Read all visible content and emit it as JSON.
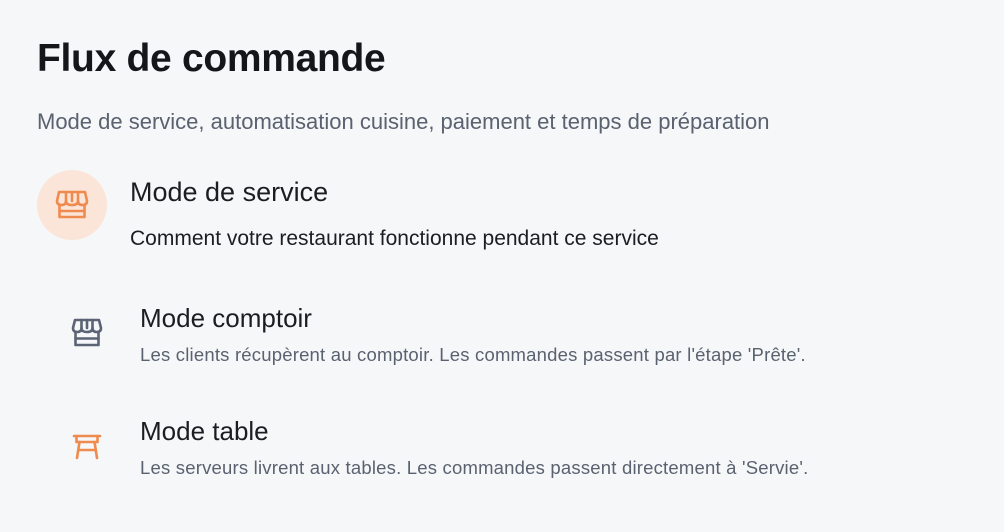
{
  "header": {
    "title": "Flux de commande",
    "subtitle": "Mode de service, automatisation cuisine, paiement et temps de préparation"
  },
  "section": {
    "icon": "storefront-icon",
    "title": "Mode de service",
    "description": "Comment votre restaurant fonctionne pendant ce service"
  },
  "options": [
    {
      "icon": "storefront-icon",
      "title": "Mode comptoir",
      "description": "Les clients récupèrent au comptoir. Les commandes passent par l'étape 'Prête'."
    },
    {
      "icon": "table-icon",
      "title": "Mode table",
      "description": "Les serveurs livrent aux tables. Les commandes passent directement à 'Servie'."
    }
  ],
  "colors": {
    "accent": "#f08b4f",
    "accent_bg": "#fbe5d8",
    "muted_icon": "#5b6474",
    "background": "#f6f7f9"
  }
}
